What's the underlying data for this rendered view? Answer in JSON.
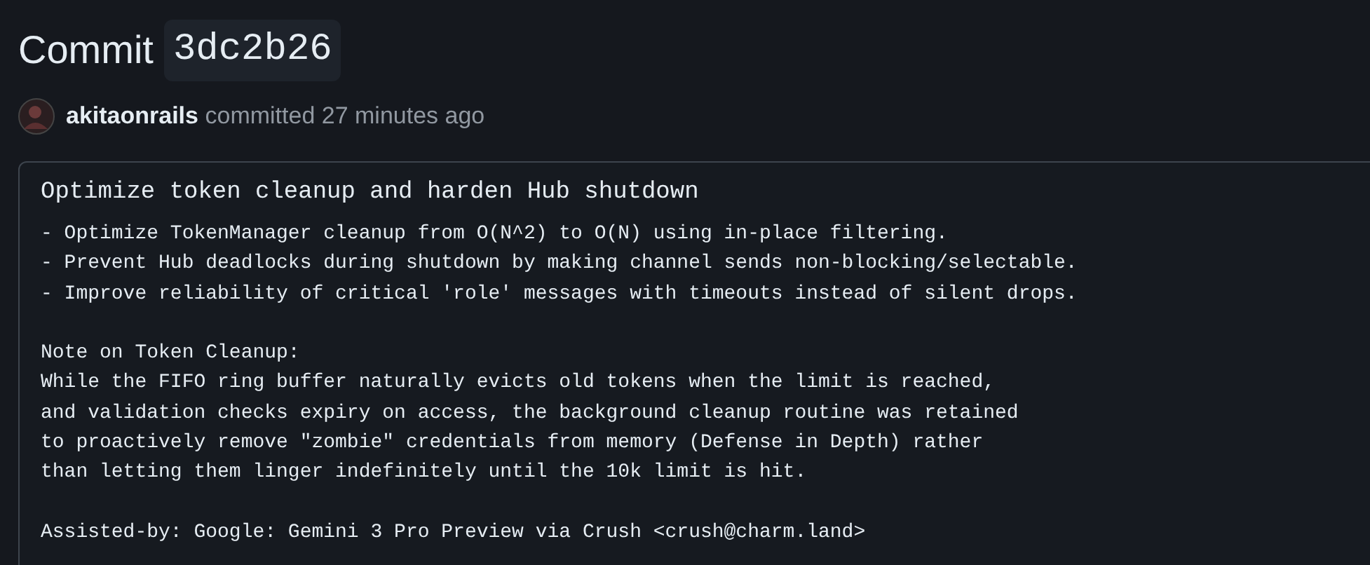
{
  "heading": {
    "label": "Commit",
    "hash": "3dc2b26"
  },
  "byline": {
    "author": "akitaonrails",
    "action": "committed",
    "time": "27 minutes ago"
  },
  "message": {
    "title": "Optimize token cleanup and harden Hub shutdown",
    "paragraphs": [
      [
        "- Optimize TokenManager cleanup from O(N^2) to O(N) using in-place filtering.",
        "- Prevent Hub deadlocks during shutdown by making channel sends non-blocking/selectable.",
        "- Improve reliability of critical 'role' messages with timeouts instead of silent drops."
      ],
      [
        "Note on Token Cleanup:",
        "While the FIFO ring buffer naturally evicts old tokens when the limit is reached,",
        "and validation checks expiry on access, the background cleanup routine was retained",
        "to proactively remove \"zombie\" credentials from memory (Defense in Depth) rather",
        "than letting them linger indefinitely until the 10k limit is hit."
      ],
      [
        "Assisted-by: Google: Gemini 3 Pro Preview via Crush <crush@charm.land>"
      ]
    ]
  }
}
